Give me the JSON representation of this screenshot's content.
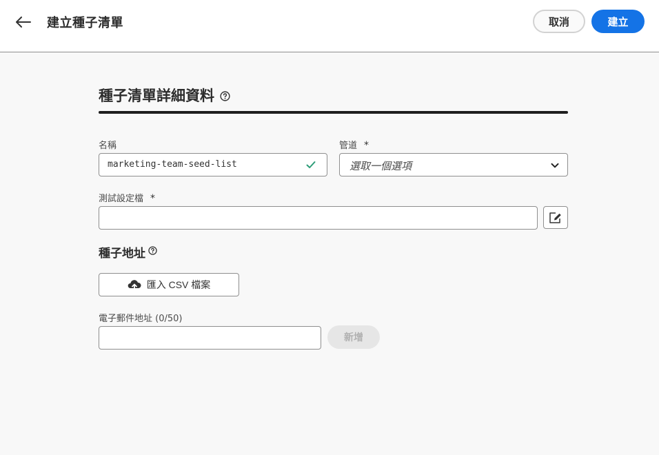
{
  "header": {
    "title": "建立種子清單",
    "cancel_label": "取消",
    "create_label": "建立"
  },
  "details": {
    "section_title": "種子清單詳細資料",
    "name_label": "名稱",
    "name_value": "marketing-team-seed-list",
    "channel_label": "管道",
    "channel_required": "*",
    "channel_placeholder": "選取一個選項",
    "test_profile_label": "測試設定檔",
    "test_profile_required": "*",
    "test_profile_value": ""
  },
  "seed_addresses": {
    "title": "種子地址",
    "import_label": "匯入 CSV 檔案",
    "email_label": "電子郵件地址 (0/50)",
    "email_value": "",
    "add_label": "新增"
  },
  "colors": {
    "accent": "#1473e6",
    "valid_check": "#2d9d78",
    "background": "#f8f8f8"
  },
  "icons": [
    "arrow-left-icon",
    "help-icon",
    "checkmark-icon",
    "chevron-down-icon",
    "edit-icon",
    "cloud-upload-icon"
  ]
}
